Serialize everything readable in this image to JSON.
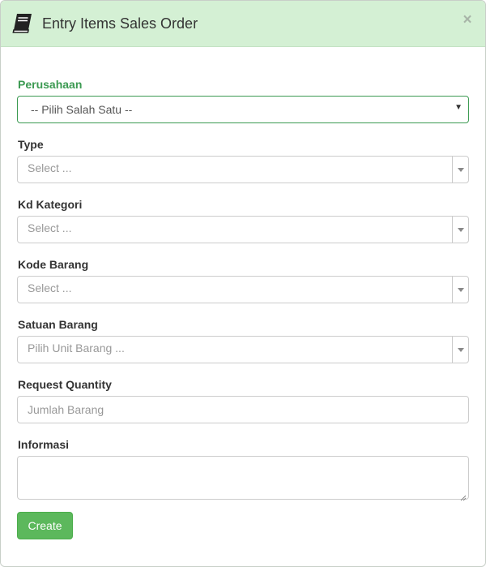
{
  "header": {
    "title": "Entry Items Sales Order",
    "close_symbol": "×",
    "icon": "book-icon",
    "background": "#d4f0d4"
  },
  "form": {
    "perusahaan": {
      "label": "Perusahaan",
      "value": "-- Pilih Salah Satu --",
      "state_color": "#3c9a52"
    },
    "type": {
      "label": "Type",
      "placeholder": "Select ..."
    },
    "kd_kategori": {
      "label": "Kd Kategori",
      "placeholder": "Select ..."
    },
    "kode_barang": {
      "label": "Kode Barang",
      "placeholder": "Select ..."
    },
    "satuan_barang": {
      "label": "Satuan Barang",
      "placeholder": "Pilih Unit Barang ..."
    },
    "request_quantity": {
      "label": "Request Quantity",
      "placeholder": "Jumlah Barang"
    },
    "informasi": {
      "label": "Informasi",
      "value": ""
    }
  },
  "actions": {
    "create_label": "Create",
    "create_color": "#5cb85c"
  }
}
